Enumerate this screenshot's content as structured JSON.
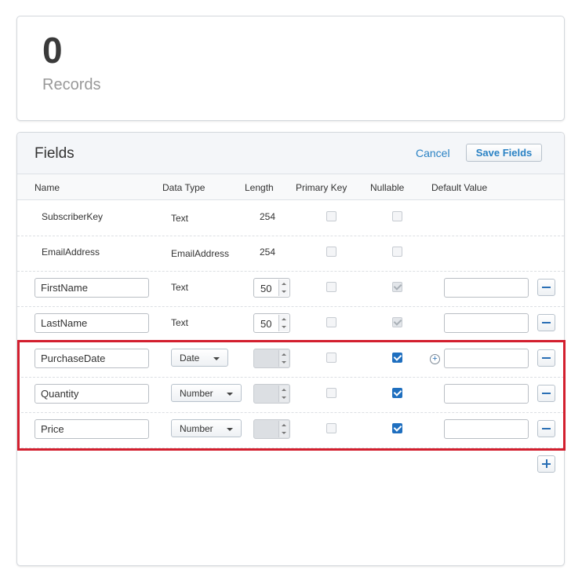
{
  "records": {
    "count": "0",
    "label": "Records"
  },
  "fields_panel": {
    "title": "Fields",
    "cancel_label": "Cancel",
    "save_label": "Save Fields",
    "columns": [
      "Name",
      "Data Type",
      "Length",
      "Primary Key",
      "Nullable",
      "Default Value"
    ],
    "rows": [
      {
        "name": "SubscriberKey",
        "data_type": "Text",
        "length": "254",
        "editable": false,
        "primary_key": false,
        "nullable": false
      },
      {
        "name": "EmailAddress",
        "data_type": "EmailAddress",
        "length": "254",
        "editable": false,
        "primary_key": false,
        "nullable": false
      },
      {
        "name": "FirstName",
        "data_type": "Text",
        "length": "50",
        "editable": true,
        "primary_key": false,
        "nullable": true,
        "default_value": ""
      },
      {
        "name": "LastName",
        "data_type": "Text",
        "length": "50",
        "editable": true,
        "primary_key": false,
        "nullable": true,
        "default_value": ""
      },
      {
        "name": "PurchaseDate",
        "data_type": "Date",
        "length": "",
        "editable": true,
        "primary_key": false,
        "nullable": true,
        "default_value": ""
      },
      {
        "name": "Quantity",
        "data_type": "Number",
        "length": "",
        "editable": true,
        "primary_key": false,
        "nullable": true,
        "default_value": ""
      },
      {
        "name": "Price",
        "data_type": "Number",
        "length": "",
        "editable": true,
        "primary_key": false,
        "nullable": true,
        "default_value": ""
      }
    ]
  },
  "icons": {
    "remove": "minus-icon",
    "add": "plus-icon",
    "date_default": "add-circle-icon",
    "dropdown": "chevron-down-icon"
  },
  "colors": {
    "accent": "#2a82c4",
    "checkbox_checked": "#1f6fbf",
    "highlight": "#d31f2e"
  }
}
